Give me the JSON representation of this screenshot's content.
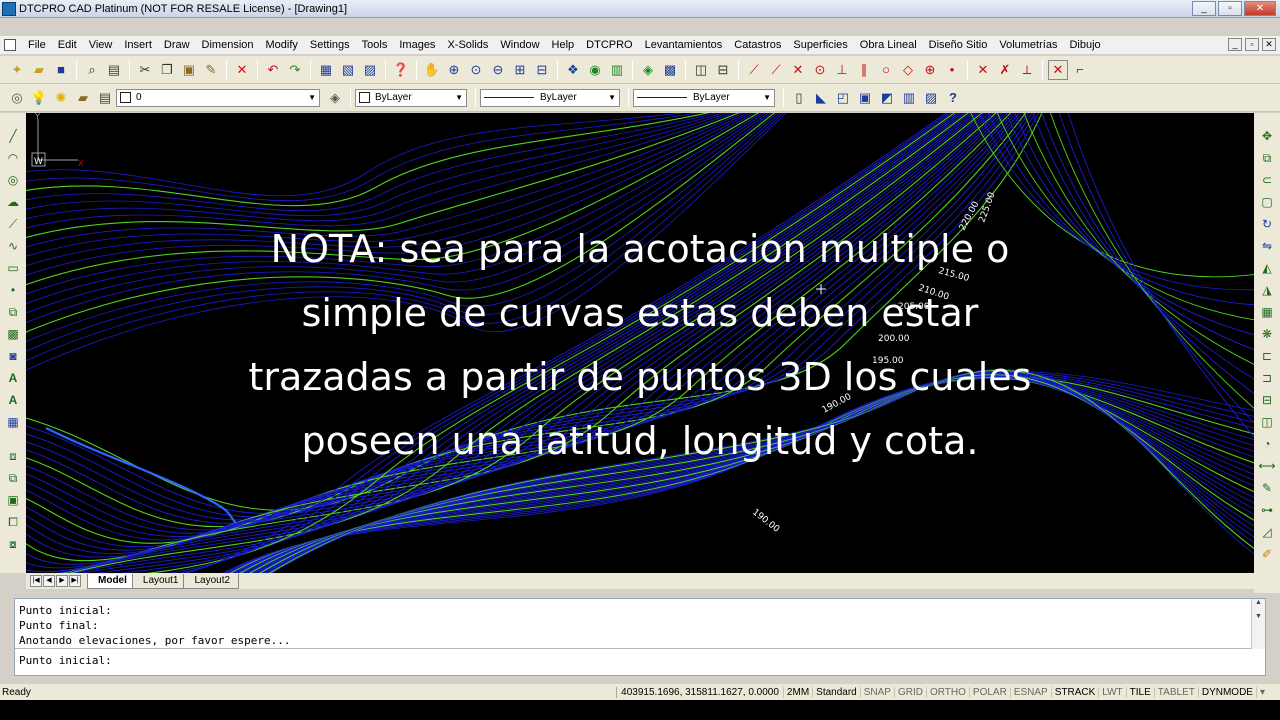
{
  "window": {
    "title": "DTCPRO CAD Platinum (NOT FOR RESALE License) - [Drawing1]",
    "buttons": [
      "_",
      "▫",
      "✕"
    ]
  },
  "menu": {
    "items": [
      "File",
      "Edit",
      "View",
      "Insert",
      "Draw",
      "Dimension",
      "Modify",
      "Settings",
      "Tools",
      "Images",
      "X-Solids",
      "Window",
      "Help",
      "DTCPRO",
      "Levantamientos",
      "Catastros",
      "Superficies",
      "Obra Lineal",
      "Diseño Sitio",
      "Volumetrías",
      "Dibujo"
    ],
    "doc_buttons": [
      "_",
      "▫",
      "✕"
    ]
  },
  "properties": {
    "layer": "0",
    "color": "ByLayer",
    "linetype": "ByLayer",
    "lineweight": "ByLayer"
  },
  "canvas": {
    "overlay_lines": [
      "NOTA: sea para la acotacion multiple o",
      "simple de curvas estas deben estar",
      "trazadas a partir de puntos 3D los cuales",
      "poseen una latitud, longitud y cota."
    ],
    "contour_labels": [
      "225.00",
      "220.00",
      "215.00",
      "210.00",
      "205.00",
      "200.00",
      "195.00",
      "190.00",
      "190.00"
    ],
    "ucs_label": "W",
    "ucs_axis_x": "X",
    "ucs_axis_y": "Y"
  },
  "layout_tabs": {
    "nav": [
      "|◀",
      "◀",
      "▶",
      "▶|"
    ],
    "tabs": [
      "Model",
      "Layout1",
      "Layout2"
    ]
  },
  "command": {
    "history": [
      "Punto inicial:",
      "Punto final:",
      "Anotando elevaciones, por favor espere..."
    ],
    "prompt": "Punto inicial:"
  },
  "status": {
    "ready": "Ready",
    "coordinates": "403915.1696, 315811.1627, 0.0000",
    "items": [
      "2MM",
      "Standard",
      "SNAP",
      "GRID",
      "ORTHO",
      "POLAR",
      "ESNAP",
      "STRACK",
      "LWT",
      "TILE",
      "TABLET",
      "DYNMODE"
    ],
    "active_items": [
      "2MM",
      "Standard",
      "STRACK",
      "TILE",
      "DYNMODE"
    ]
  },
  "colors": {
    "canvas_bg": "#000000",
    "contour_minor": "#1c1ccf",
    "contour_major": "#4fd12a",
    "overlay_text": "#ffffff"
  },
  "toolbar_icons": [
    "new-icon",
    "open-icon",
    "save-icon",
    "print-preview-icon",
    "print-icon",
    "cut-icon",
    "copy-icon",
    "paste-icon",
    "match-properties-icon",
    "delete-icon",
    "undo-icon",
    "redo-icon",
    "properties-icon",
    "design-center-icon",
    "tool-palette-icon",
    "help-icon",
    "pan-icon",
    "zoom-realtime-icon",
    "zoom-window-icon",
    "zoom-previous-icon",
    "zoom-in-icon",
    "zoom-out-icon",
    "regen-icon",
    "layer-icon",
    "snap-endpoint-icon",
    "snap-midpoint-icon",
    "snap-intersection-icon",
    "snap-center-icon",
    "snap-perpendicular-icon",
    "snap-tangent-icon",
    "snap-node-icon",
    "snap-none-icon"
  ]
}
